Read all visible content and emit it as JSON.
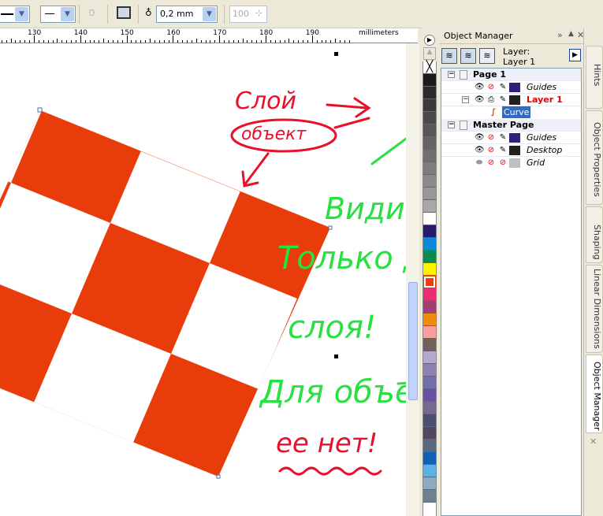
{
  "toolbar": {
    "outline_width": "0,2 mm",
    "transparency_value": "100"
  },
  "ruler": {
    "labels": [
      "130",
      "140",
      "150",
      "160",
      "170",
      "180",
      "190"
    ],
    "units": "millimeters"
  },
  "docker": {
    "title": "Object Manager",
    "layer_label": "Layer:",
    "layer_name": "Layer 1",
    "tree": {
      "page1": "Page 1",
      "page1_guides": "Guides",
      "layer1": "Layer 1",
      "curve": "Curve",
      "master": "Master Page",
      "master_guides": "Guides",
      "desktop": "Desktop",
      "grid": "Grid"
    },
    "colors": {
      "guides": "#2e1f78",
      "layer1": "#231f1c",
      "desktop": "#231f1c",
      "grid": "#c0c0c0",
      "accent_red": "#e60000"
    }
  },
  "tabs": [
    "Hints",
    "Object Properties",
    "Shaping",
    "Linear Dimensions",
    "Object Manager"
  ],
  "palette": [
    "#1a1a1a",
    "#2b2b2b",
    "#3a3a3a",
    "#4a4a4a",
    "#575757",
    "#646464",
    "#707070",
    "#7d7d7d",
    "#8a8a8a",
    "#979797",
    "#a8a8a8",
    "#ffffff",
    "#2a1a6e",
    "#0a8ad8",
    "#0a8a50",
    "#fff200",
    "#e84010",
    "#e83070",
    "#a04070",
    "#f08a10",
    "#f8a0a0",
    "#6e625a",
    "#b4a8d0",
    "#9080b0",
    "#7070a8",
    "#6a50a0",
    "#786890",
    "#485070",
    "#504860",
    "#5a6880",
    "#1060b8",
    "#60b0e8",
    "#90a8c0",
    "#708090"
  ],
  "annotations": {
    "layer": "Слой",
    "object": "объект",
    "line1": "Видимость",
    "line2": "Только для",
    "line3": "слоя!",
    "line4": "Для объекта —",
    "line5": "ее нет!"
  },
  "shape": {
    "fill": "#e83c0a"
  }
}
